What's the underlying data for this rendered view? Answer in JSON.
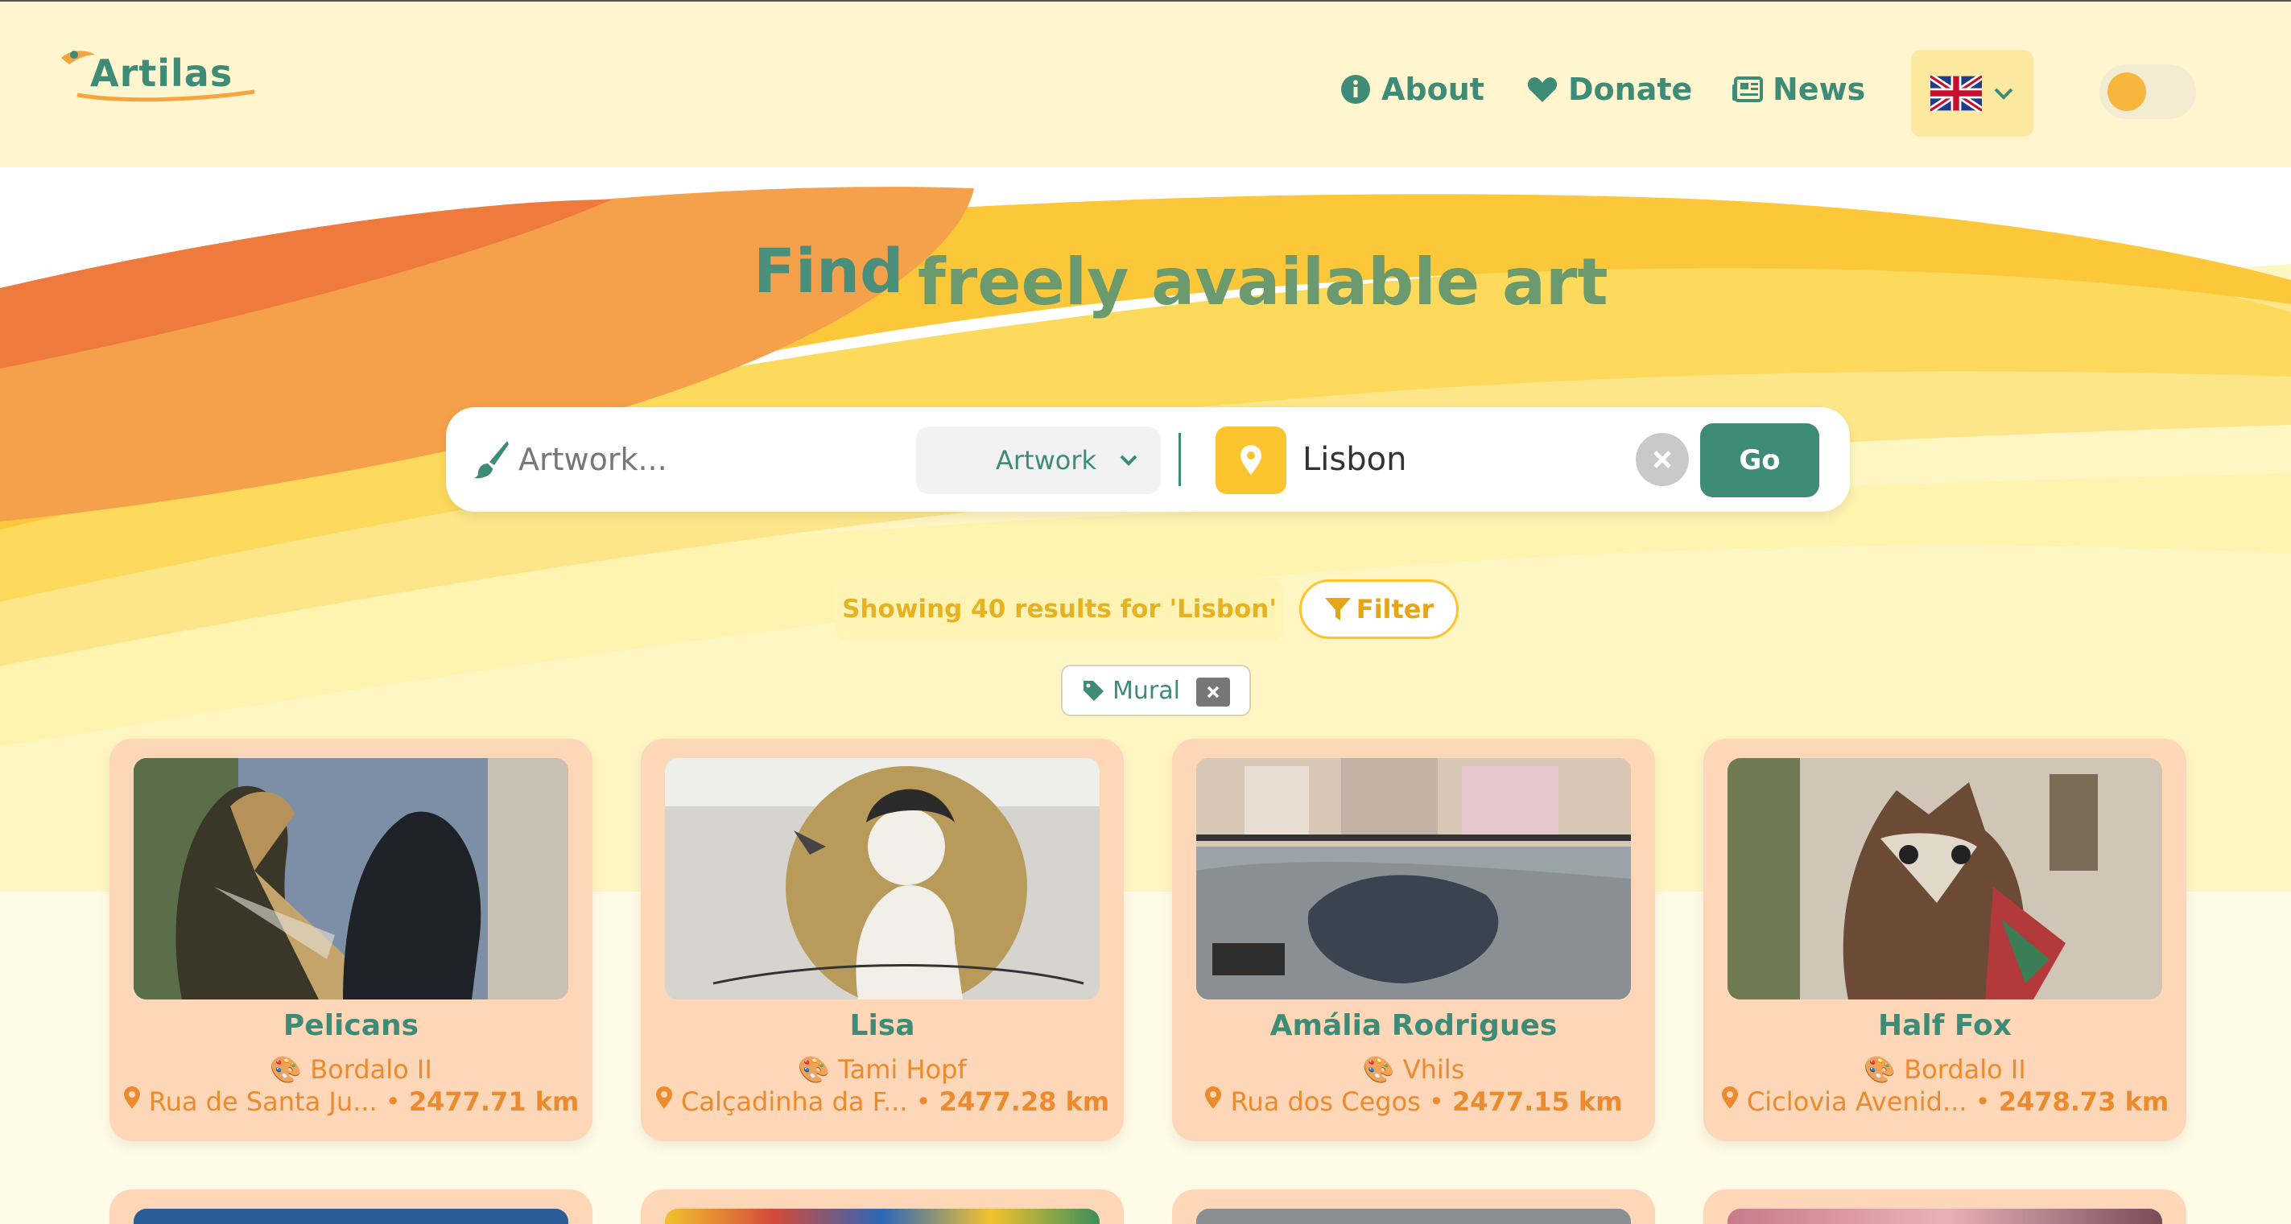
{
  "app": {
    "logo_text": "Artilas"
  },
  "nav": {
    "about": "About",
    "donate": "Donate",
    "news": "News"
  },
  "hero": {
    "word1": "Find",
    "word2": "freely available art"
  },
  "search": {
    "artwork_placeholder": "Artwork...",
    "type_selected": "Artwork",
    "location_value": "Lisbon",
    "go_label": "Go"
  },
  "results": {
    "summary": "Showing 40 results for 'Lisbon'",
    "filter_label": "Filter",
    "active_tag": "Mural"
  },
  "cards": [
    {
      "title": "Pelicans",
      "artist": "Bordalo II",
      "location": "Rua de Santa Ju...",
      "distance": "2477.71 km"
    },
    {
      "title": "Lisa",
      "artist": "Tami Hopf",
      "location": "Calçadinha da F...",
      "distance": "2477.28 km"
    },
    {
      "title": "Amália Rodrigues",
      "artist": "Vhils",
      "location": "Rua dos Cegos",
      "distance": "2477.15 km"
    },
    {
      "title": "Half Fox",
      "artist": "Bordalo II",
      "location": "Ciclovia Avenid...",
      "distance": "2478.73 km"
    }
  ],
  "colors": {
    "brand_green": "#3e8c78",
    "accent_yellow": "#fdc42f",
    "accent_orange": "#ec8a2e",
    "card_bg": "#fdd7b7"
  },
  "icons": {
    "about": "info-circle-icon",
    "donate": "heart-icon",
    "news": "newspaper-icon",
    "language": "uk-flag-icon",
    "search_artwork": "paintbrush-icon",
    "location": "map-pin-icon",
    "clear": "close-icon",
    "filter": "filter-icon",
    "tag": "tag-icon",
    "artist": "palette-icon"
  }
}
